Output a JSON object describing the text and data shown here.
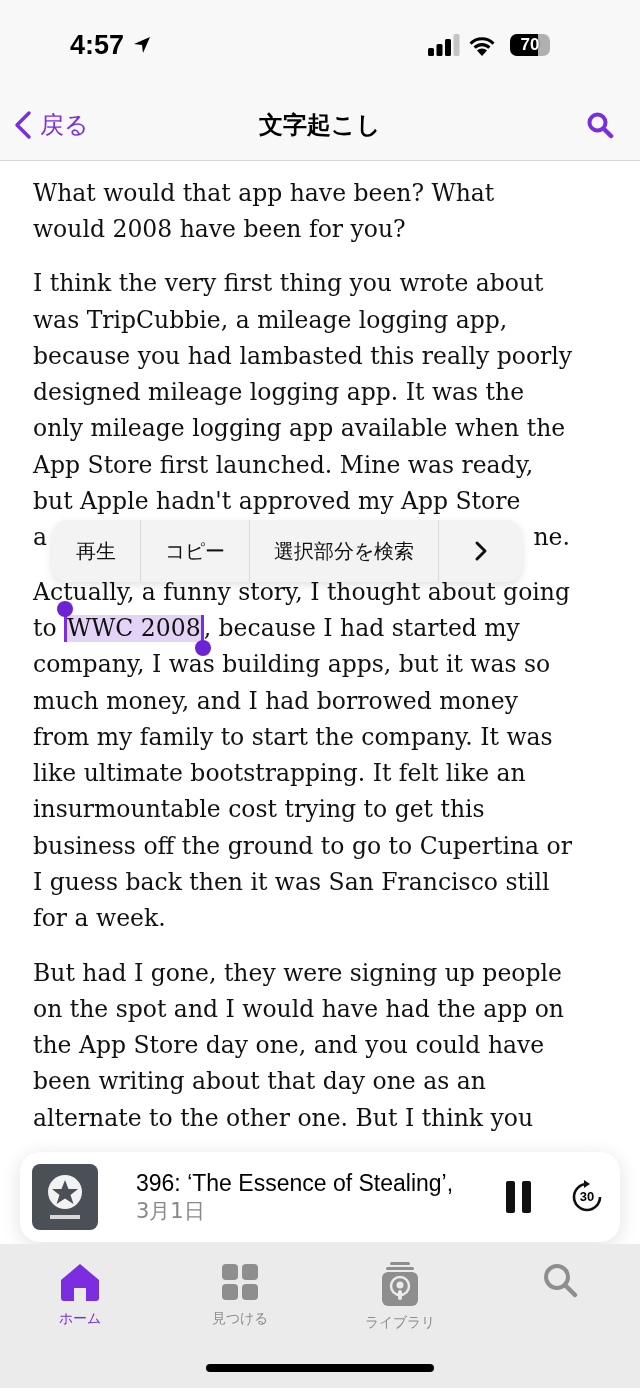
{
  "status_bar": {
    "time": "4:57",
    "battery": {
      "text": "70",
      "level": 0.7
    }
  },
  "nav": {
    "back": "戻る",
    "title": "文字起こし"
  },
  "paragraphs": [
    {
      "lines": [
        "What would that app have been? What",
        "would 2008 have been for you?"
      ]
    },
    {
      "lines": [
        "I think the very first thing you wrote about",
        "was TripCubbie, a mileage logging app,",
        "because you had lambasted this really poorly",
        "designed mileage logging app. It was the",
        "only mileage logging app available when the",
        "App Store first launched. Mine was ready,",
        "but Apple hadn't approved my App Store",
        {
          "kind": "covered",
          "parts": [
            "a",
            "ne."
          ]
        }
      ]
    },
    {
      "lines": [
        "Actually, a funny story, I thought about going",
        {
          "kind": "selection",
          "parts": [
            {
              "text": "to ",
              "selected": false
            },
            {
              "text": "WWC 2008",
              "selected": true
            },
            {
              "text": ", because I had started my",
              "selected": false
            }
          ]
        },
        "company, I was building apps, but it was so",
        "much money, and I had borrowed money",
        "from my family to start the company. It was",
        "like ultimate bootstrapping. It felt like an",
        "insurmountable cost trying to get this",
        "business off the ground to go to Cupertina or",
        "I guess back then it was San Francisco still",
        "for a week."
      ]
    },
    {
      "lines": [
        "But had I gone, they were signing up people",
        "on the spot and I would have had the app on",
        "the App Store day one, and you could have",
        "been writing about that day one as an",
        "alternate to the other one. But I think you"
      ]
    }
  ],
  "edit_menu": {
    "items": [
      "再生",
      "コピー",
      "選択部分を検索"
    ]
  },
  "mini_player": {
    "title": "396: ‘The Essence of Stealing’,",
    "date": "3月1日",
    "skip_seconds": "30",
    "playing": true
  },
  "tabs": [
    {
      "kind": "home",
      "label": "ホーム",
      "selected": true
    },
    {
      "kind": "browse",
      "label": "見つける",
      "selected": false
    },
    {
      "kind": "library",
      "label": "ライブラリ",
      "selected": false
    },
    {
      "kind": "search",
      "selected": false
    }
  ]
}
